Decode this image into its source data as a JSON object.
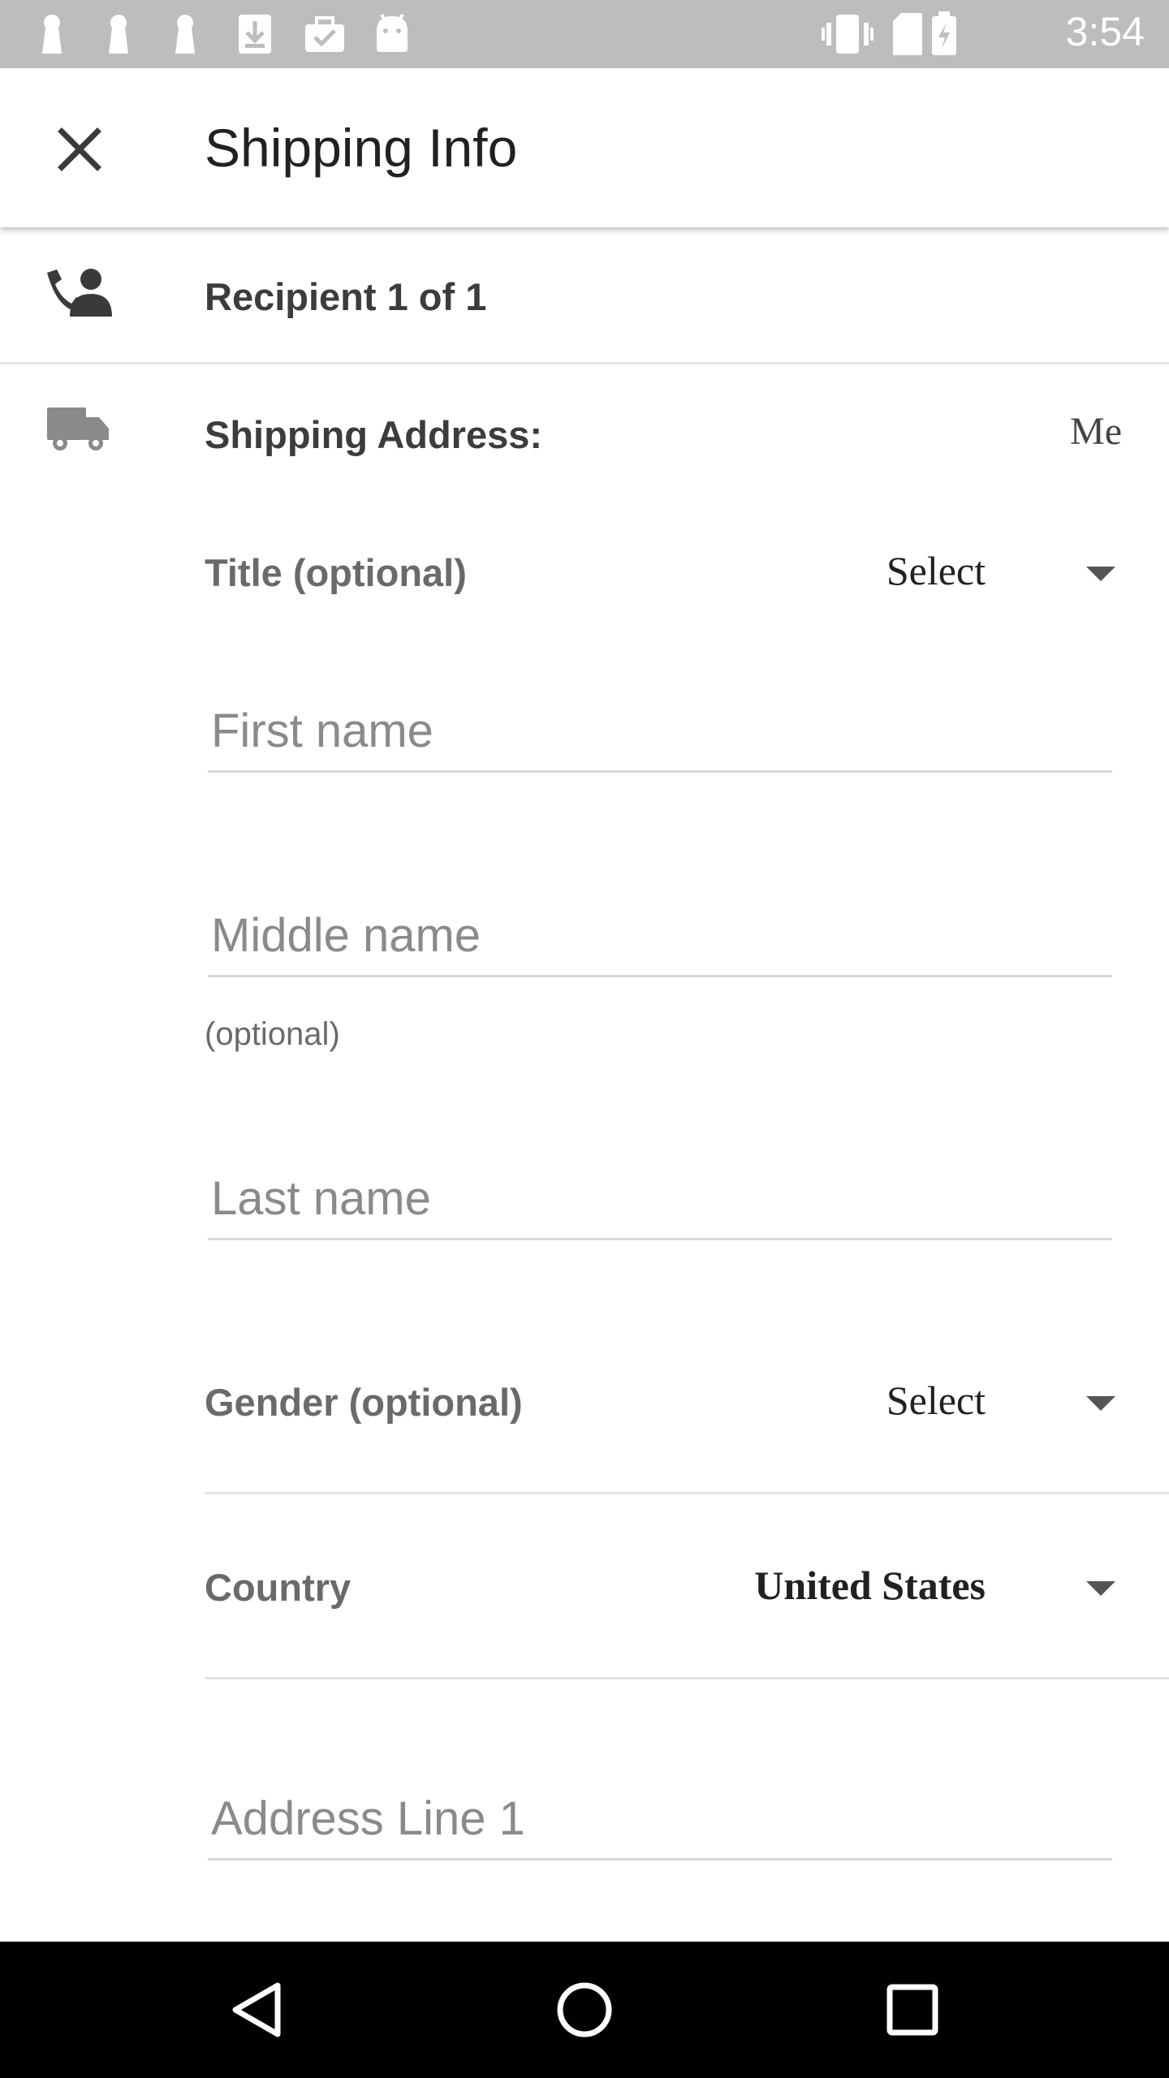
{
  "status_bar": {
    "time": "3:54",
    "icons": [
      "notification-icon",
      "notification-icon",
      "notification-icon",
      "download-icon",
      "briefcase-check-icon",
      "android-icon",
      "vibrate-icon",
      "sim-icon",
      "battery-icon"
    ]
  },
  "app_bar": {
    "title": "Shipping Info",
    "close_icon": "close-icon"
  },
  "recipient": {
    "icon": "person-phone-icon",
    "text": "Recipient 1 of 1"
  },
  "shipping_address": {
    "icon": "truck-icon",
    "label": "Shipping Address:",
    "value": "Me"
  },
  "form": {
    "title": {
      "label": "Title (optional)",
      "value": "Select"
    },
    "first_name": {
      "placeholder": "First name",
      "value": ""
    },
    "middle_name": {
      "placeholder": "Middle name",
      "value": "",
      "helper": "(optional)"
    },
    "last_name": {
      "placeholder": "Last name",
      "value": ""
    },
    "gender": {
      "label": "Gender (optional)",
      "value": "Select"
    },
    "country": {
      "label": "Country",
      "value": "United States"
    },
    "address_line_1": {
      "placeholder": "Address Line 1",
      "value": ""
    }
  },
  "nav_bar": {
    "back": "back-icon",
    "home": "home-icon",
    "recents": "recents-icon"
  },
  "colors": {
    "status_bar": "#bdbdbd",
    "nav_bar": "#000000",
    "text_primary": "#212121",
    "placeholder": "#8a8a8a"
  }
}
